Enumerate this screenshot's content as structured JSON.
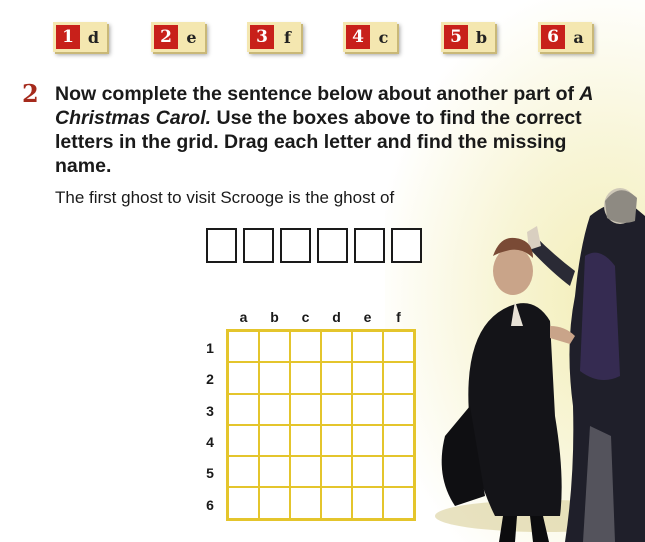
{
  "clues": [
    {
      "num": "1",
      "letter": "d"
    },
    {
      "num": "2",
      "letter": "e"
    },
    {
      "num": "3",
      "letter": "f"
    },
    {
      "num": "4",
      "letter": "c"
    },
    {
      "num": "5",
      "letter": "b"
    },
    {
      "num": "6",
      "letter": "a"
    }
  ],
  "question": {
    "number": "2",
    "text_before": "Now complete the sentence below about another part of ",
    "title": "A Christmas Carol.",
    "text_after": " Use the boxes above to find the correct letters in the grid. Drag each letter and find the missing name."
  },
  "sentence": "The first ghost to visit Scrooge is the ghost of",
  "grid": {
    "columns": [
      "a",
      "b",
      "c",
      "d",
      "e",
      "f"
    ],
    "rows": [
      "1",
      "2",
      "3",
      "4",
      "5",
      "6"
    ]
  },
  "colors": {
    "accent_red": "#c8201a",
    "grid_yellow": "#e4c52c",
    "clue_bg": "#f4e7b0"
  }
}
